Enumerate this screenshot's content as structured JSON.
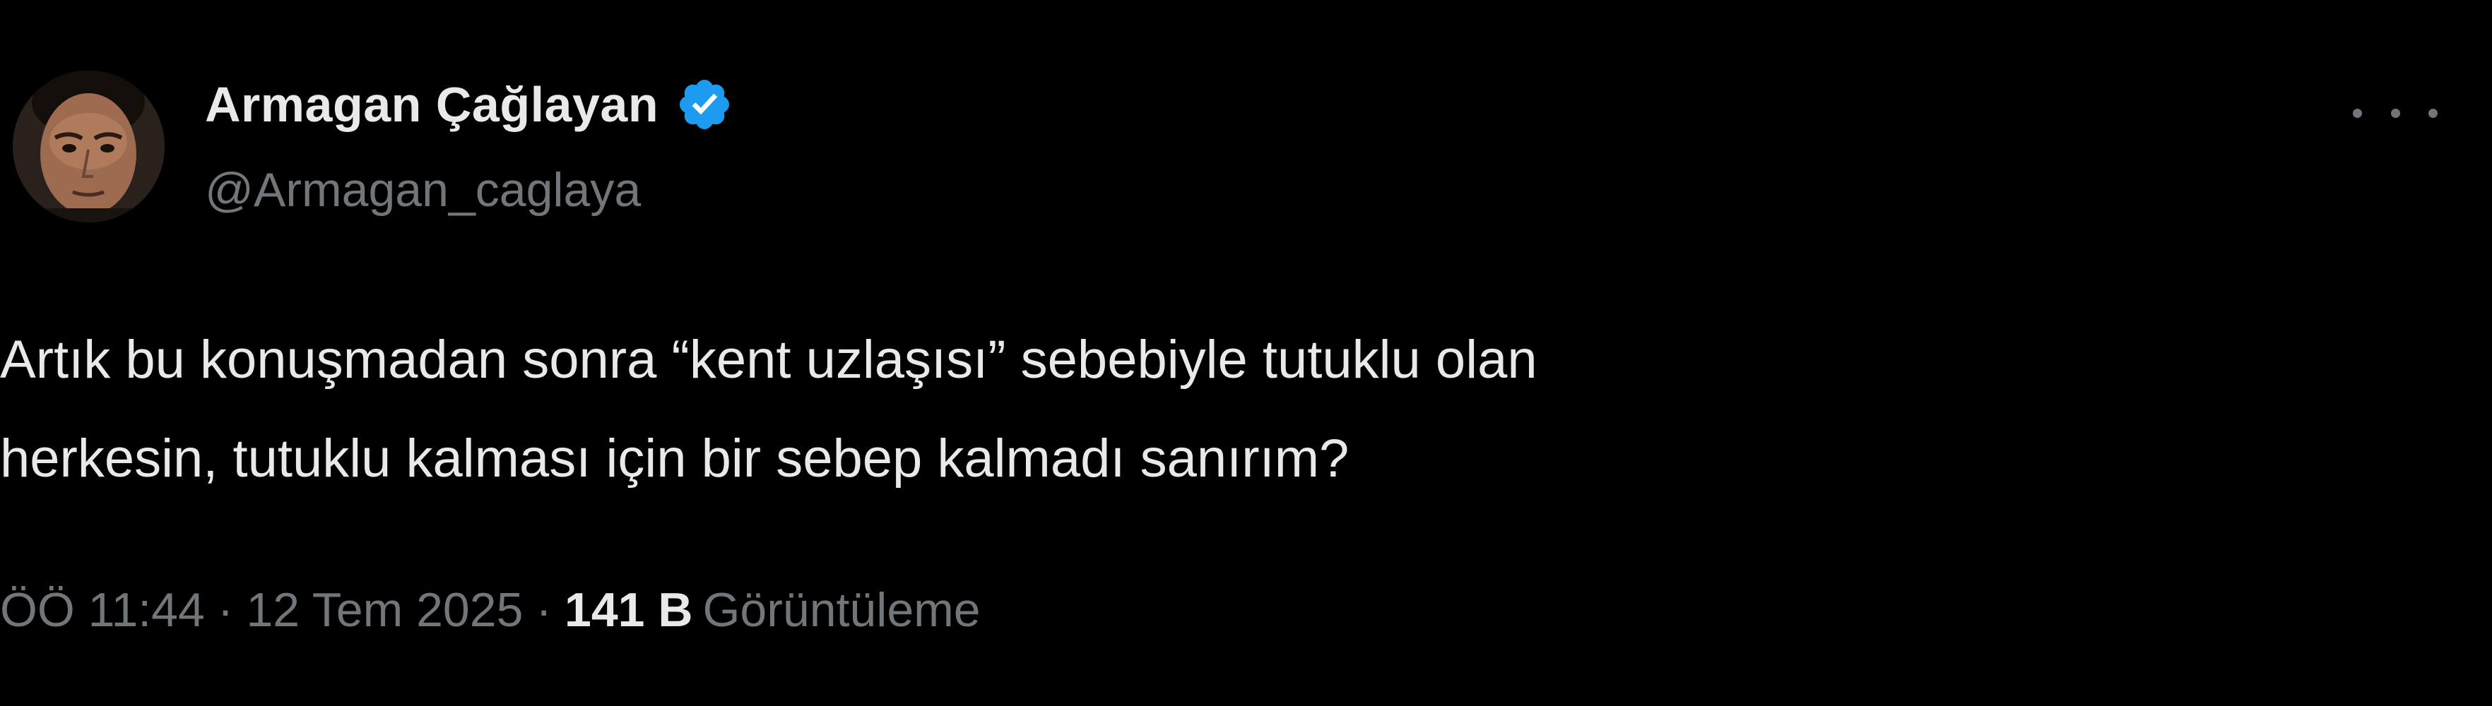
{
  "author": {
    "display_name": "Armagan Çağlayan",
    "handle": "@Armagan_caglaya",
    "verified": true
  },
  "tweet": {
    "text_lines": [
      "Artık bu konuşmadan sonra “kent uzlaşısı” sebebiyle tutuklu olan",
      "herkesin, tutuklu kalması için bir sebep kalmadı sanırım?"
    ],
    "time": "ÖÖ 11:44",
    "separator": "·",
    "date": "12 Tem 2025",
    "views_count": "141 B",
    "views_label": "Görüntüleme"
  },
  "icons": {
    "verified": "verified-badge-icon",
    "more": "more-options-icon"
  },
  "colors": {
    "background": "#000000",
    "primary_text": "#e7e9ea",
    "secondary_text": "#71767b",
    "verified_blue": "#1d9bf0"
  }
}
